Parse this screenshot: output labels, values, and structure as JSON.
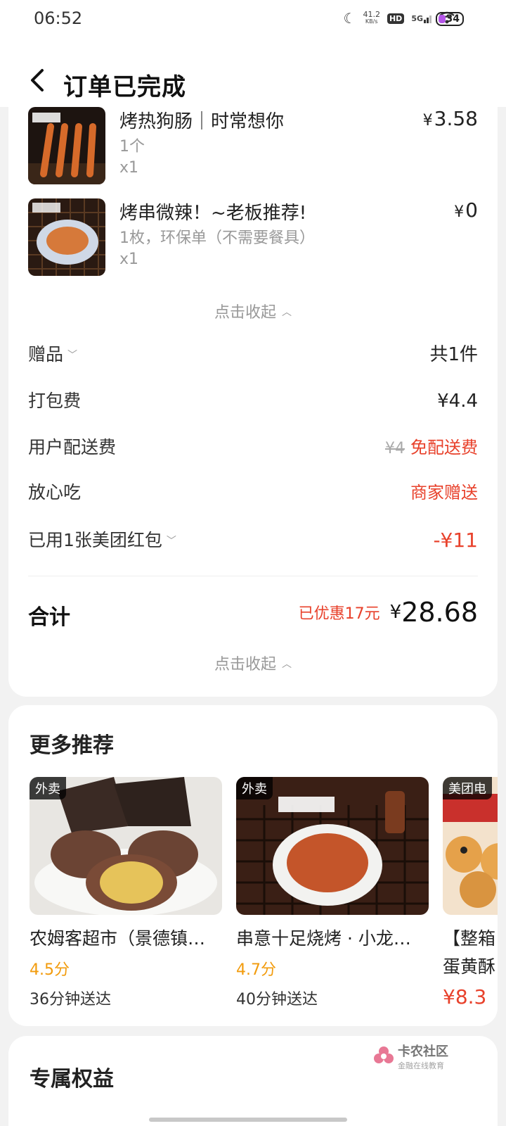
{
  "status": {
    "time": "06:52",
    "net_speed_value": "41.2",
    "net_speed_unit": "KB/s",
    "hd": "HD",
    "signal": "5G",
    "battery": "34"
  },
  "header": {
    "back_label": "‹",
    "title": "订单已完成"
  },
  "items": [
    {
      "name": "烤热狗肠｜时常想你",
      "spec": "1个",
      "qty": "x1",
      "price": "3.58",
      "currency": "¥"
    },
    {
      "name": "烤串微辣！~老板推荐!",
      "spec": "1枚，环保单（不需要餐具）",
      "qty": "x1",
      "price": "0",
      "currency": "¥"
    }
  ],
  "collapse_label": "点击收起",
  "fees": {
    "gift_label": "赠品",
    "gift_value": "共1件",
    "packing_label": "打包费",
    "packing_value": "¥4.4",
    "delivery_label": "用户配送费",
    "delivery_original": "¥4",
    "delivery_value": "免配送费",
    "safe_label": "放心吃",
    "safe_value": "商家赠送",
    "coupon_label": "已用1张美团红包",
    "coupon_value": "-¥11"
  },
  "total": {
    "label": "合计",
    "saved": "已优惠17元",
    "currency": "¥",
    "amount": "28.68"
  },
  "recommend": {
    "title": "更多推荐",
    "cards": [
      {
        "tag": "外卖",
        "name": "农姆客超市（景德镇…",
        "score": "4.5分",
        "eta": "36分钟送达"
      },
      {
        "tag": "外卖",
        "name": "串意十足烧烤 · 小龙…",
        "score": "4.7分",
        "eta": "40分钟送达"
      },
      {
        "tag": "美团电",
        "name": "【整箱",
        "name2": "蛋黄酥",
        "price": "¥8.3"
      }
    ]
  },
  "benefits": {
    "title": "专属权益"
  },
  "watermark": {
    "main": "卡农社区",
    "sub": "金融在线教育"
  },
  "colors": {
    "accent_red": "#e8412b",
    "score_orange": "#f29b0c",
    "battery_purple": "#b455e8"
  }
}
